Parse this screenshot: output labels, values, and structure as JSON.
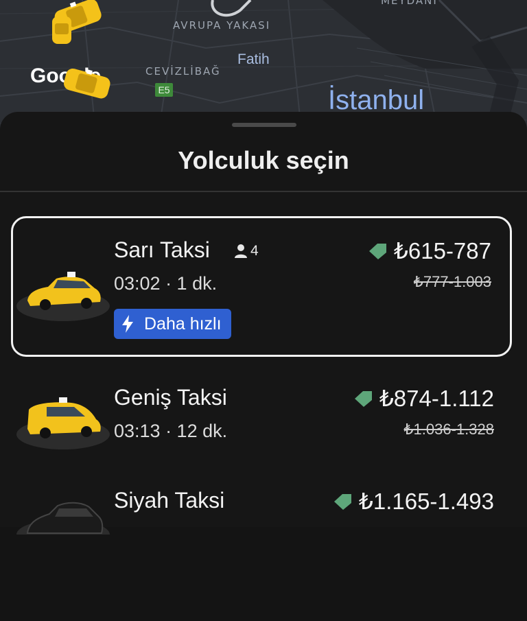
{
  "map": {
    "labels": {
      "meydani": "MEYDANI",
      "avrupa_yakasi": "AVRUPA YAKASI",
      "cevizlibag": "CEVİZLİBAĞ",
      "fatih": "Fatih",
      "istanbul": "İstanbul",
      "e5": "E5",
      "google": "Google"
    }
  },
  "sheet": {
    "title": "Yolculuk seçin"
  },
  "rides": [
    {
      "name": "Sarı Taksi",
      "passengers": "4",
      "time": "03:02 · 1 dk.",
      "badge": "Daha hızlı",
      "price": "₺615-787",
      "old_price": "₺777-1.003",
      "car_color": "#f5c518"
    },
    {
      "name": "Geniş Taksi",
      "time": "03:13 · 12 dk.",
      "price": "₺874-1.112",
      "old_price": "₺1.036-1.328",
      "car_color": "#f5c518"
    },
    {
      "name": "Siyah Taksi",
      "price": "₺1.165-1.493",
      "car_color": "#1b1b1b"
    }
  ],
  "colors": {
    "badge_bg": "#2f60d1",
    "discount_tag": "#5ea67a",
    "sheet_bg": "#161616"
  }
}
